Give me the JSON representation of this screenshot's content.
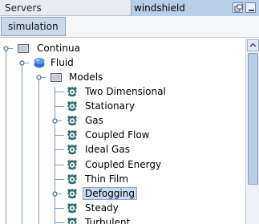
{
  "tabs": {
    "servers_label": "Servers",
    "active_title": "windshield"
  },
  "toolbar": {
    "simulation_tab": "simulation"
  },
  "tree": {
    "continua": "Continua",
    "fluid": "Fluid",
    "models": "Models",
    "items": [
      "Two Dimensional",
      "Stationary",
      "Gas",
      "Coupled Flow",
      "Ideal Gas",
      "Coupled Energy",
      "Thin Film",
      "Defogging",
      "Steady",
      "Turbulent"
    ],
    "selected": "Defogging"
  },
  "colors": {
    "tab_active_bg": "#b9cfe8",
    "selection_bg": "#c7daf0",
    "model_icon": "#2f6e6e"
  },
  "icons": {
    "folder": "folder-icon",
    "fluid": "fluid-region-icon",
    "model": "model-icon",
    "expand": "expand-handle-icon"
  }
}
